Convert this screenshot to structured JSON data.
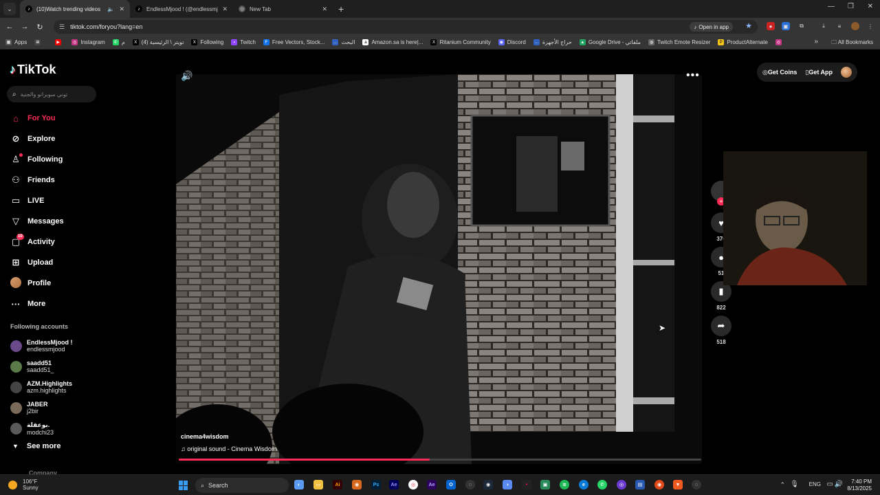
{
  "browser": {
    "tabs": [
      {
        "label": "(10)Watch trending videos",
        "active": true
      },
      {
        "label": "EndlessMjood ! (@endlessmjood",
        "active": false
      },
      {
        "label": "New Tab",
        "active": false
      }
    ],
    "url": "tiktok.com/foryou?lang=en",
    "open_in_app": "Open in app",
    "bookmarks": [
      "Apps",
      "Instagram",
      "م",
      "تويتر \\ الرئيسية (4)",
      "Following",
      "Twitch",
      "Free Vectors, Stock...",
      "البحث",
      "Amazon.sa is here|...",
      "Ritanium Community",
      "Discord",
      "حراج الأجهزة",
      "Google Drive - ملفاتي",
      "Twitch Emote Resizer",
      "ProductAlternate"
    ],
    "all_bookmarks": "All Bookmarks"
  },
  "sidebar": {
    "logo": "TikTok",
    "search_placeholder": "توني سوبرانو والجنية",
    "nav": [
      {
        "label": "For You",
        "icon": "home-icon",
        "active": true
      },
      {
        "label": "Explore",
        "icon": "compass-icon"
      },
      {
        "label": "Following",
        "icon": "following-icon"
      },
      {
        "label": "Friends",
        "icon": "friends-icon"
      },
      {
        "label": "LIVE",
        "icon": "live-icon"
      },
      {
        "label": "Messages",
        "icon": "messages-icon"
      },
      {
        "label": "Activity",
        "icon": "activity-icon",
        "badge": "10"
      },
      {
        "label": "Upload",
        "icon": "upload-icon"
      },
      {
        "label": "Profile",
        "icon": "profile-icon"
      },
      {
        "label": "More",
        "icon": "more-icon"
      }
    ],
    "following_title": "Following accounts",
    "following_accounts": [
      {
        "name": "EndlessMjood !",
        "handle": "endlessmjood"
      },
      {
        "name": "saadd51",
        "handle": "saadd51_"
      },
      {
        "name": "AZM.Highlights",
        "handle": "azm.highlights"
      },
      {
        "name": "JABER",
        "handle": "j2bir"
      },
      {
        "name": "بوعقلة.",
        "handle": "modchi23"
      }
    ],
    "see_more": "See more",
    "company": "Company"
  },
  "video": {
    "author": "cinema4wisdom",
    "sound": "original sound - Cinema Wisdom",
    "progress": 0.48,
    "likes": "376",
    "comments": "51",
    "saves": "822",
    "shares": "518"
  },
  "header": {
    "get_coins": "Get Coins",
    "get_app": "Get App"
  },
  "taskbar": {
    "temp": "106°F",
    "weather": "Sunny",
    "search": "Search",
    "lang": "ENG",
    "time": "7:40 PM",
    "date": "8/13/2025"
  },
  "colors": {
    "accent": "#fe2c55",
    "bg": "#000000"
  }
}
